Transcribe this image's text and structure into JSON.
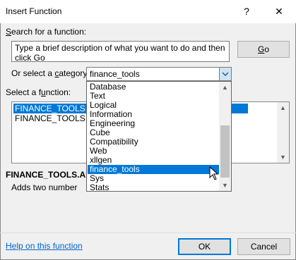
{
  "window": {
    "title": "Insert Function",
    "help_glyph": "?",
    "close_glyph": "✕"
  },
  "search": {
    "label_underlined": "S",
    "label_rest": "earch for a function:",
    "description_text": "Type a brief description of what you want to do and then click Go",
    "go_label_underlined": "G",
    "go_label_rest": "o"
  },
  "category": {
    "label_prefix": "Or select a ",
    "label_underlined": "c",
    "label_rest": "ategory:",
    "selected": "finance_tools",
    "options": [
      "Database",
      "Text",
      "Logical",
      "Information",
      "Engineering",
      "Cube",
      "Compatibility",
      "Web",
      "xllgen",
      "finance_tools",
      "Sys",
      "Stats"
    ],
    "highlighted_index": 9
  },
  "functions": {
    "label_prefix": "Select a f",
    "label_underlined": "u",
    "label_rest": "nction:",
    "items": [
      "FINANCE_TOOLS.AD",
      "FINANCE_TOOLS.MU"
    ],
    "selected_index": 0
  },
  "details": {
    "signature": "FINANCE_TOOLS.AD",
    "description": "Adds two number"
  },
  "footer": {
    "help_link": "Help on this function",
    "ok_label": "OK",
    "cancel_label": "Cancel"
  },
  "colors": {
    "selection": "#0078d7",
    "link": "#0066cc",
    "dropdown_button": "#cce4f7"
  }
}
